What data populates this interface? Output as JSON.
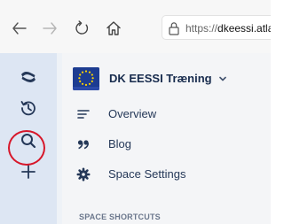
{
  "browser": {
    "url_prefix": "https://",
    "url_host": "dkeessi.atlassia"
  },
  "space": {
    "name": "DK EESSI Træning"
  },
  "space_menu": [
    {
      "label": "Overview",
      "icon": "overview-lines-icon"
    },
    {
      "label": "Blog",
      "icon": "quote-icon"
    },
    {
      "label": "Space Settings",
      "icon": "gear-icon"
    }
  ],
  "shortcuts": {
    "title": "SPACE SHORTCUTS"
  },
  "colors": {
    "global_sidebar_bg": "#dde6f3",
    "space_sidebar_bg": "#f4f5f7",
    "highlight": "#d7172a",
    "eu_flag_blue": "#1d3c91",
    "eu_star_yellow": "#ffd500"
  }
}
